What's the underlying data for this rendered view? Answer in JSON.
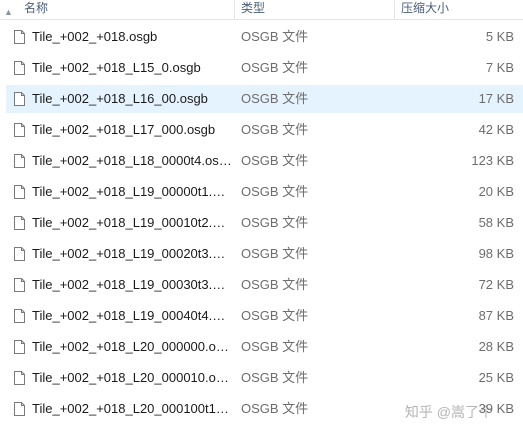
{
  "columns": {
    "name": "名称",
    "type": "类型",
    "size": "压缩大小"
  },
  "files": [
    {
      "name": "Tile_+002_+018.osgb",
      "type": "OSGB 文件",
      "size": "5 KB",
      "selected": false
    },
    {
      "name": "Tile_+002_+018_L15_0.osgb",
      "type": "OSGB 文件",
      "size": "7 KB",
      "selected": false
    },
    {
      "name": "Tile_+002_+018_L16_00.osgb",
      "type": "OSGB 文件",
      "size": "17 KB",
      "selected": true
    },
    {
      "name": "Tile_+002_+018_L17_000.osgb",
      "type": "OSGB 文件",
      "size": "42 KB",
      "selected": false
    },
    {
      "name": "Tile_+002_+018_L18_0000t4.osgb",
      "type": "OSGB 文件",
      "size": "123 KB",
      "selected": false
    },
    {
      "name": "Tile_+002_+018_L19_00000t1.os...",
      "type": "OSGB 文件",
      "size": "20 KB",
      "selected": false
    },
    {
      "name": "Tile_+002_+018_L19_00010t2.os...",
      "type": "OSGB 文件",
      "size": "58 KB",
      "selected": false
    },
    {
      "name": "Tile_+002_+018_L19_00020t3.os...",
      "type": "OSGB 文件",
      "size": "98 KB",
      "selected": false
    },
    {
      "name": "Tile_+002_+018_L19_00030t3.os...",
      "type": "OSGB 文件",
      "size": "72 KB",
      "selected": false
    },
    {
      "name": "Tile_+002_+018_L19_00040t4.os...",
      "type": "OSGB 文件",
      "size": "87 KB",
      "selected": false
    },
    {
      "name": "Tile_+002_+018_L20_000000.os...",
      "type": "OSGB 文件",
      "size": "28 KB",
      "selected": false
    },
    {
      "name": "Tile_+002_+018_L20_000010.os...",
      "type": "OSGB 文件",
      "size": "25 KB",
      "selected": false
    },
    {
      "name": "Tile_+002_+018_L20_000100t1.o...",
      "type": "OSGB 文件",
      "size": "39 KB",
      "selected": false
    }
  ],
  "watermark": "知乎 @嵩了个",
  "icons": {
    "sort": "sort-up-icon",
    "file": "file-icon"
  },
  "colors": {
    "selected_row": "#e5f3ff",
    "header_text": "#4c607a",
    "secondary_text": "#6d6d6d"
  }
}
